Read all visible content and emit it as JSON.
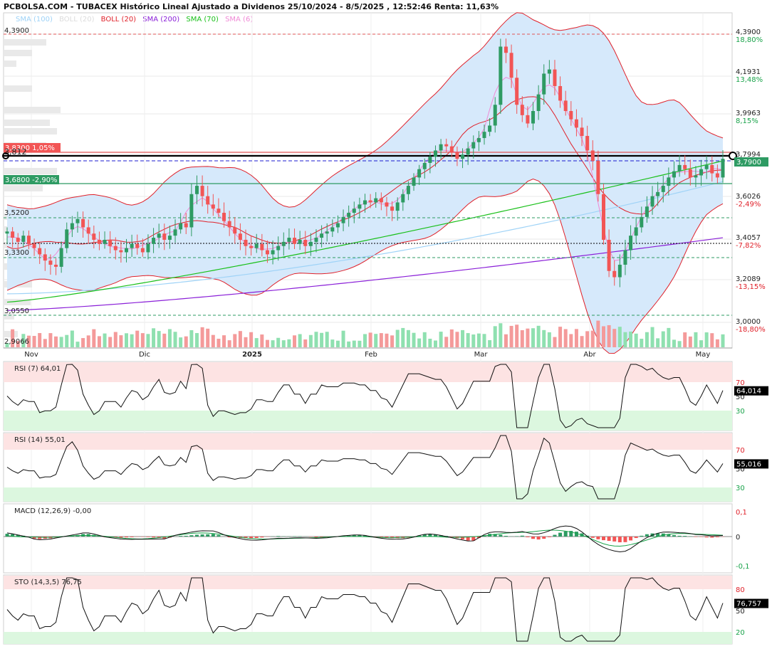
{
  "header": {
    "title": "PCBOLSA.COM - TUBACEX Histórico Lineal Ajustado a Dividenos 25/10/2024 - 8/5/2025 , 12:52:46 Renta: 11,63%"
  },
  "legend": [
    {
      "label": "SMA (100)",
      "color": "#9fd3f7"
    },
    {
      "label": "BOLL (20)",
      "color": "#dcdcdc"
    },
    {
      "label": "BOLL (20)",
      "color": "#e0212a"
    },
    {
      "label": "SMA (200)",
      "color": "#8a1fd8"
    },
    {
      "label": "SMA (70)",
      "color": "#19c019"
    },
    {
      "label": "SMA (6)",
      "color": "#f08ad6"
    }
  ],
  "colors": {
    "up": "#2e9b63",
    "down": "#f25555",
    "vol_up": "#8fe0b0",
    "vol_down": "#f49a9a",
    "boll_fill": "#d6e9fb",
    "boll_line": "#e0212a",
    "sma100": "#9fd3f7",
    "sma200": "#8a1fd8",
    "sma70": "#19c019",
    "sma6": "#f08ad6",
    "ob_band": "#fde3e3",
    "os_band": "#dcf7df",
    "grid": "#e8e8e8"
  },
  "price_panel": {
    "price_ticks": [
      "4,3900",
      "4,1931",
      "3,9963",
      "3,7994",
      "3,6026",
      "3,4057",
      "3,2089",
      "3,0000"
    ],
    "pct_ticks": [
      "18,80%",
      "13,48%",
      "8,15%",
      "",
      "-2,49%",
      "-7,82%",
      "-13,15%",
      "-18,80%"
    ],
    "left_labels": [
      "4,3900",
      "3,5200",
      "3,3300",
      "3,0550",
      "2,9066"
    ],
    "resistance_box": {
      "price": "3,8300",
      "pct": "1,05%"
    },
    "support_box": {
      "price": "3,6800",
      "pct": "-2,90%"
    },
    "cross_label": "3,812",
    "current_price": "3,7900",
    "month_labels": [
      "Nov",
      "Dic",
      "2025",
      "Feb",
      "Mar",
      "Abr",
      "May"
    ]
  },
  "panels": {
    "rsi7": {
      "title": "RSI (7)",
      "value": "64,01",
      "current": "64,014",
      "ticks": [
        "70",
        "50",
        "30"
      ]
    },
    "rsi14": {
      "title": "RSI (14)",
      "value": "55,01",
      "current": "55,016",
      "ticks": [
        "70",
        "50",
        "30"
      ]
    },
    "macd": {
      "title": "MACD (12,26,9)",
      "value": "-0,00",
      "ticks": [
        "0,1",
        "0",
        "-0,1"
      ]
    },
    "sto": {
      "title": "STO (14,3,5)",
      "value": "76,75",
      "current": "76,757",
      "ticks": [
        "80",
        "50",
        "20"
      ]
    }
  },
  "chart_data": {
    "type": "candlestick",
    "title": "TUBACEX Histórico Lineal Ajustado a Dividenos 25/10/2024 - 8/5/2025",
    "x_range": [
      "25/10/2024",
      "8/5/2025"
    ],
    "y_range": [
      2.9066,
      4.39
    ],
    "close": [
      3.44,
      3.41,
      3.39,
      3.42,
      3.38,
      3.36,
      3.33,
      3.3,
      3.28,
      3.27,
      3.36,
      3.45,
      3.48,
      3.5,
      3.46,
      3.43,
      3.4,
      3.38,
      3.4,
      3.37,
      3.35,
      3.34,
      3.36,
      3.38,
      3.36,
      3.34,
      3.38,
      3.41,
      3.43,
      3.4,
      3.42,
      3.45,
      3.48,
      3.46,
      3.62,
      3.66,
      3.61,
      3.57,
      3.55,
      3.53,
      3.49,
      3.46,
      3.43,
      3.4,
      3.37,
      3.36,
      3.38,
      3.35,
      3.33,
      3.35,
      3.37,
      3.39,
      3.41,
      3.38,
      3.4,
      3.37,
      3.39,
      3.41,
      3.43,
      3.44,
      3.46,
      3.48,
      3.51,
      3.53,
      3.55,
      3.57,
      3.59,
      3.58,
      3.6,
      3.58,
      3.56,
      3.54,
      3.58,
      3.62,
      3.66,
      3.7,
      3.74,
      3.77,
      3.8,
      3.83,
      3.86,
      3.85,
      3.82,
      3.79,
      3.81,
      3.84,
      3.87,
      3.89,
      3.92,
      3.95,
      4.05,
      4.33,
      4.3,
      4.18,
      4.05,
      4.0,
      3.96,
      4.02,
      4.1,
      4.2,
      4.22,
      4.14,
      4.07,
      4.02,
      3.98,
      3.94,
      3.9,
      3.83,
      3.78,
      3.62,
      3.4,
      3.25,
      3.22,
      3.28,
      3.35,
      3.42,
      3.46,
      3.51,
      3.56,
      3.61,
      3.63,
      3.66,
      3.7,
      3.73,
      3.76,
      3.74,
      3.7,
      3.71,
      3.74,
      3.76,
      3.72,
      3.7,
      3.79
    ],
    "sma_100": "rising from 3.14 to 3.68",
    "sma_200": "rising from 3.06 to 3.41",
    "sma_70": "rising from 3.06 to 3.78",
    "indicators": {
      "rsi_7_last": 64.01,
      "rsi_14_last": 55.01,
      "macd_last": -0.0,
      "sto_last": 76.75
    }
  }
}
